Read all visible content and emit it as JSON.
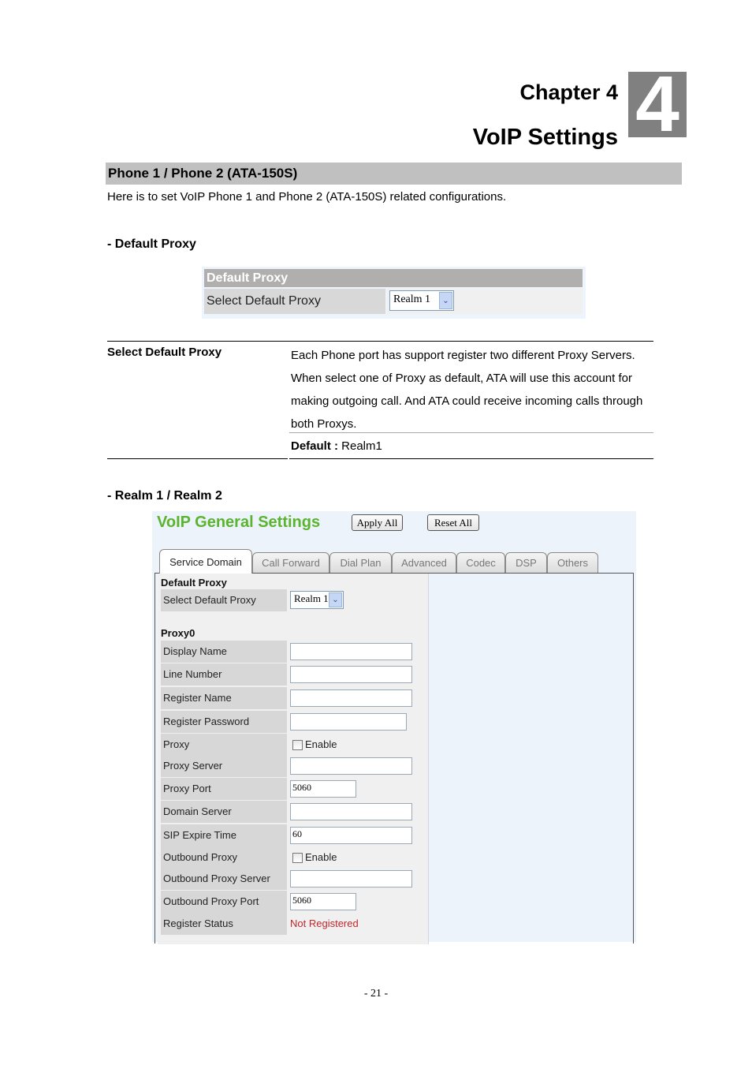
{
  "chapter": {
    "title": "Chapter 4",
    "subtitle": "VoIP Settings",
    "number": "4"
  },
  "section": {
    "heading": "Phone 1 / Phone 2 (ATA-150S)",
    "intro": "Here is to set VoIP Phone 1 and Phone 2 (ATA-150S) related configurations."
  },
  "default_proxy": {
    "subheading": "- Default Proxy",
    "widget": {
      "header": "Default Proxy",
      "label": "Select Default Proxy",
      "selected": "Realm 1"
    },
    "description": {
      "key": "Select Default Proxy",
      "text": "Each Phone port has support register two different Proxy Servers. When select one of Proxy as default, ATA will use this account for making outgoing call. And ATA could receive incoming calls through both Proxys.",
      "default_label": "Default :",
      "default_value": " Realm1"
    }
  },
  "realm": {
    "subheading": "- Realm 1 / Realm 2",
    "panel": {
      "title": "VoIP General Settings",
      "apply_all": "Apply All",
      "reset_all": "Reset All",
      "tabs": [
        {
          "label": "Service Domain",
          "active": true
        },
        {
          "label": "Call Forward",
          "active": false
        },
        {
          "label": "Dial Plan",
          "active": false
        },
        {
          "label": "Advanced",
          "active": false
        },
        {
          "label": "Codec",
          "active": false
        },
        {
          "label": "DSP",
          "active": false
        },
        {
          "label": "Others",
          "active": false
        }
      ],
      "default_proxy_group": "Default Proxy",
      "select_default_proxy_label": "Select Default Proxy",
      "select_default_proxy_value": "Realm 1",
      "proxy_group": "Proxy0",
      "fields": [
        {
          "label": "Display Name",
          "type": "text",
          "value": ""
        },
        {
          "label": "Line Number",
          "type": "text",
          "value": ""
        },
        {
          "label": "Register Name",
          "type": "text",
          "value": ""
        },
        {
          "label": "Register Password",
          "type": "password",
          "value": ""
        },
        {
          "label": "Proxy",
          "type": "checkbox",
          "checkbox_label": "Enable",
          "checked": false
        },
        {
          "label": "Proxy Server",
          "type": "text",
          "value": ""
        },
        {
          "label": "Proxy Port",
          "type": "text-short",
          "value": "5060"
        },
        {
          "label": "Domain Server",
          "type": "text",
          "value": ""
        },
        {
          "label": "SIP Expire Time",
          "type": "text",
          "value": "60"
        },
        {
          "label": "Outbound Proxy",
          "type": "checkbox",
          "checkbox_label": "Enable",
          "checked": false
        },
        {
          "label": "Outbound Proxy Server",
          "type": "text",
          "value": ""
        },
        {
          "label": "Outbound Proxy Port",
          "type": "text-short",
          "value": "5060"
        },
        {
          "label": "Register Status",
          "type": "status",
          "value": "Not Registered"
        }
      ]
    }
  },
  "footer": {
    "page_number": "- 21 -"
  }
}
